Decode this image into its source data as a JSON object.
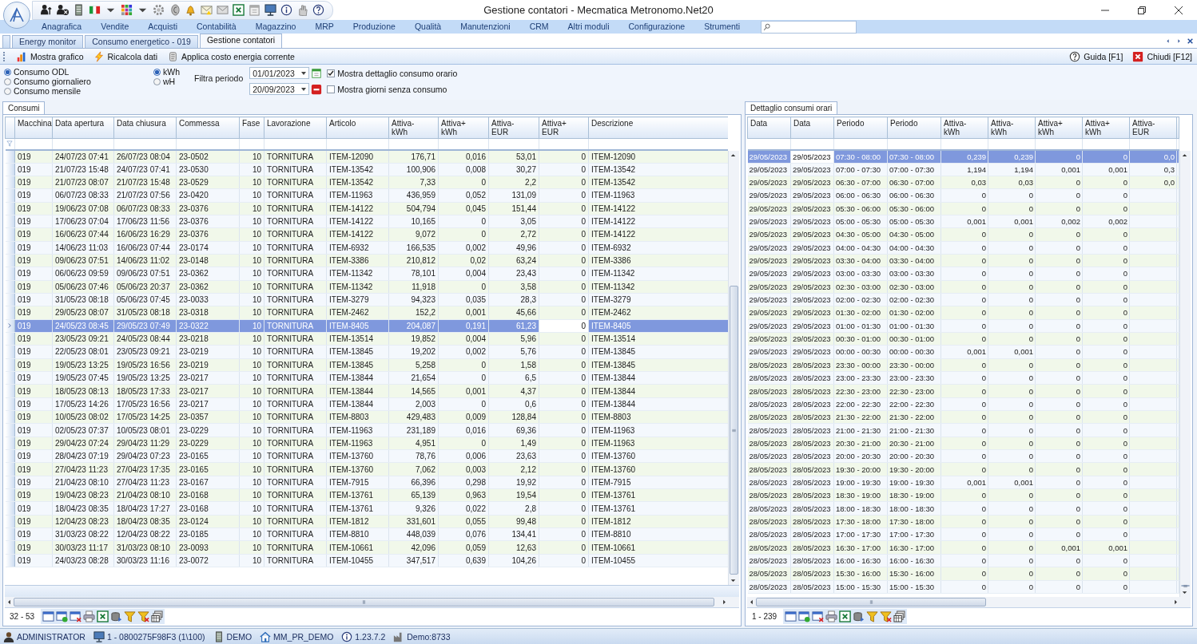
{
  "window": {
    "title": "Gestione contatori - Mecmatica Metronomo.Net20"
  },
  "menu": [
    "Anagrafica",
    "Vendite",
    "Acquisti",
    "Contabilità",
    "Magazzino",
    "MRP",
    "Produzione",
    "Qualità",
    "Manutenzioni",
    "CRM",
    "Altri moduli",
    "Configurazione",
    "Strumenti"
  ],
  "doc_tabs": [
    {
      "label": "Energy monitor",
      "selected": false
    },
    {
      "label": "Consumo energetico - 019",
      "selected": false
    },
    {
      "label": "Gestione contatori",
      "selected": true
    }
  ],
  "toolbar": {
    "left": [
      {
        "kind": "chart",
        "label": "Mostra grafico"
      },
      {
        "kind": "lightning",
        "label": "Ricalcola dati"
      },
      {
        "kind": "scroll",
        "label": "Applica costo energia corrente"
      }
    ],
    "right": [
      {
        "kind": "help",
        "label": "Guida [F1]"
      },
      {
        "kind": "close",
        "label": "Chiudi [F12]"
      }
    ]
  },
  "mode": [
    {
      "label": "Consumo ODL",
      "selected": true
    },
    {
      "label": "Consumo giornaliero",
      "selected": false
    },
    {
      "label": "Consumo mensile",
      "selected": false
    }
  ],
  "unit": [
    {
      "label": "kWh",
      "selected": true
    },
    {
      "label": "wH",
      "selected": false
    }
  ],
  "filter": {
    "label": "Filtra periodo",
    "from": "01/01/2023",
    "to": "20/09/2023"
  },
  "options": [
    {
      "label": "Mostra dettaglio consumo orario",
      "checked": true
    },
    {
      "label": "Mostra giorni senza consumo",
      "checked": false
    }
  ],
  "consumi": {
    "tab": "Consumi",
    "pager": "32 - 53",
    "columns": [
      {
        "label": "Macchina",
        "numeric": false
      },
      {
        "label": "Data apertura",
        "numeric": false
      },
      {
        "label": "Data chiusura",
        "numeric": false
      },
      {
        "label": "Commessa",
        "numeric": false
      },
      {
        "label": "Fase",
        "numeric": true
      },
      {
        "label": "Lavorazione",
        "numeric": false
      },
      {
        "label": "Articolo",
        "numeric": false
      },
      {
        "label": "Attiva-\nkWh",
        "numeric": true
      },
      {
        "label": "Attiva+\nkWh",
        "numeric": true
      },
      {
        "label": "Attiva-\nEUR",
        "numeric": true
      },
      {
        "label": "Attiva+\nEUR",
        "numeric": true
      },
      {
        "label": "Descrizione",
        "numeric": false
      }
    ],
    "rows": [
      {
        "selected": false,
        "cells": [
          "019",
          "24/07/23 07:41",
          "26/07/23 08:04",
          "23-0502",
          "10",
          "TORNITURA",
          "ITEM-12090",
          "176,71",
          "0,016",
          "53,01",
          "0",
          "ITEM-12090"
        ]
      },
      {
        "selected": false,
        "cells": [
          "019",
          "21/07/23 15:48",
          "24/07/23 07:41",
          "23-0530",
          "10",
          "TORNITURA",
          "ITEM-13542",
          "100,906",
          "0,008",
          "30,27",
          "0",
          "ITEM-13542"
        ]
      },
      {
        "selected": false,
        "cells": [
          "019",
          "21/07/23 08:07",
          "21/07/23 15:48",
          "23-0529",
          "10",
          "TORNITURA",
          "ITEM-13542",
          "7,33",
          "0",
          "2,2",
          "0",
          "ITEM-13542"
        ]
      },
      {
        "selected": false,
        "cells": [
          "019",
          "06/07/23 08:33",
          "21/07/23 07:56",
          "23-0420",
          "10",
          "TORNITURA",
          "ITEM-11963",
          "436,959",
          "0,052",
          "131,09",
          "0",
          "ITEM-11963"
        ]
      },
      {
        "selected": false,
        "cells": [
          "019",
          "19/06/23 07:08",
          "06/07/23 08:33",
          "23-0376",
          "10",
          "TORNITURA",
          "ITEM-14122",
          "504,794",
          "0,045",
          "151,44",
          "0",
          "ITEM-14122"
        ]
      },
      {
        "selected": false,
        "cells": [
          "019",
          "17/06/23 07:04",
          "17/06/23 11:56",
          "23-0376",
          "10",
          "TORNITURA",
          "ITEM-14122",
          "10,165",
          "0",
          "3,05",
          "0",
          "ITEM-14122"
        ]
      },
      {
        "selected": false,
        "cells": [
          "019",
          "16/06/23 07:44",
          "16/06/23 16:29",
          "23-0376",
          "10",
          "TORNITURA",
          "ITEM-14122",
          "9,072",
          "0",
          "2,72",
          "0",
          "ITEM-14122"
        ]
      },
      {
        "selected": false,
        "cells": [
          "019",
          "14/06/23 11:03",
          "16/06/23 07:44",
          "23-0174",
          "10",
          "TORNITURA",
          "ITEM-6932",
          "166,535",
          "0,002",
          "49,96",
          "0",
          "ITEM-6932"
        ]
      },
      {
        "selected": false,
        "cells": [
          "019",
          "09/06/23 07:51",
          "14/06/23 11:02",
          "23-0148",
          "10",
          "TORNITURA",
          "ITEM-3386",
          "210,812",
          "0,02",
          "63,24",
          "0",
          "ITEM-3386"
        ]
      },
      {
        "selected": false,
        "cells": [
          "019",
          "06/06/23 09:59",
          "09/06/23 07:51",
          "23-0362",
          "10",
          "TORNITURA",
          "ITEM-11342",
          "78,101",
          "0,004",
          "23,43",
          "0",
          "ITEM-11342"
        ]
      },
      {
        "selected": false,
        "cells": [
          "019",
          "05/06/23 07:46",
          "05/06/23 20:37",
          "23-0362",
          "10",
          "TORNITURA",
          "ITEM-11342",
          "11,918",
          "0",
          "3,58",
          "0",
          "ITEM-11342"
        ]
      },
      {
        "selected": false,
        "cells": [
          "019",
          "31/05/23 08:18",
          "05/06/23 07:45",
          "23-0033",
          "10",
          "TORNITURA",
          "ITEM-3279",
          "94,323",
          "0,035",
          "28,3",
          "0",
          "ITEM-3279"
        ]
      },
      {
        "selected": false,
        "cells": [
          "019",
          "29/05/23 08:07",
          "31/05/23 08:18",
          "23-0318",
          "10",
          "TORNITURA",
          "ITEM-2462",
          "152,2",
          "0,001",
          "45,66",
          "0",
          "ITEM-2462"
        ]
      },
      {
        "selected": true,
        "cells": [
          "019",
          "24/05/23 08:45",
          "29/05/23 07:49",
          "23-0322",
          "10",
          "TORNITURA",
          "ITEM-8405",
          "204,087",
          "0,191",
          "61,23",
          {
            "text": "0",
            "focused": true
          },
          "ITEM-8405"
        ]
      },
      {
        "selected": false,
        "cells": [
          "019",
          "23/05/23 09:21",
          "24/05/23 08:44",
          "23-0218",
          "10",
          "TORNITURA",
          "ITEM-13514",
          "19,852",
          "0,004",
          "5,96",
          "0",
          "ITEM-13514"
        ]
      },
      {
        "selected": false,
        "cells": [
          "019",
          "22/05/23 08:01",
          "23/05/23 09:21",
          "23-0219",
          "10",
          "TORNITURA",
          "ITEM-13845",
          "19,202",
          "0,002",
          "5,76",
          "0",
          "ITEM-13845"
        ]
      },
      {
        "selected": false,
        "cells": [
          "019",
          "19/05/23 13:25",
          "19/05/23 16:56",
          "23-0219",
          "10",
          "TORNITURA",
          "ITEM-13845",
          "5,258",
          "0",
          "1,58",
          "0",
          "ITEM-13845"
        ]
      },
      {
        "selected": false,
        "cells": [
          "019",
          "19/05/23 07:45",
          "19/05/23 13:25",
          "23-0217",
          "10",
          "TORNITURA",
          "ITEM-13844",
          "21,654",
          "0",
          "6,5",
          "0",
          "ITEM-13844"
        ]
      },
      {
        "selected": false,
        "cells": [
          "019",
          "18/05/23 08:13",
          "18/05/23 17:33",
          "23-0217",
          "10",
          "TORNITURA",
          "ITEM-13844",
          "14,565",
          "0,001",
          "4,37",
          "0",
          "ITEM-13844"
        ]
      },
      {
        "selected": false,
        "cells": [
          "019",
          "17/05/23 14:26",
          "17/05/23 16:56",
          "23-0217",
          "10",
          "TORNITURA",
          "ITEM-13844",
          "2,003",
          "0",
          "0,6",
          "0",
          "ITEM-13844"
        ]
      },
      {
        "selected": false,
        "cells": [
          "019",
          "10/05/23 08:02",
          "17/05/23 14:25",
          "23-0357",
          "10",
          "TORNITURA",
          "ITEM-8803",
          "429,483",
          "0,009",
          "128,84",
          "0",
          "ITEM-8803"
        ]
      },
      {
        "selected": false,
        "cells": [
          "019",
          "02/05/23 07:37",
          "10/05/23 08:01",
          "23-0229",
          "10",
          "TORNITURA",
          "ITEM-11963",
          "231,189",
          "0,016",
          "69,36",
          "0",
          "ITEM-11963"
        ]
      },
      {
        "selected": false,
        "cells": [
          "019",
          "29/04/23 07:24",
          "29/04/23 11:29",
          "23-0229",
          "10",
          "TORNITURA",
          "ITEM-11963",
          "4,951",
          "0",
          "1,49",
          "0",
          "ITEM-11963"
        ]
      },
      {
        "selected": false,
        "cells": [
          "019",
          "28/04/23 07:19",
          "29/04/23 07:23",
          "23-0165",
          "10",
          "TORNITURA",
          "ITEM-13760",
          "78,76",
          "0,006",
          "23,63",
          "0",
          "ITEM-13760"
        ]
      },
      {
        "selected": false,
        "cells": [
          "019",
          "27/04/23 11:23",
          "27/04/23 17:35",
          "23-0165",
          "10",
          "TORNITURA",
          "ITEM-13760",
          "7,062",
          "0,003",
          "2,12",
          "0",
          "ITEM-13760"
        ]
      },
      {
        "selected": false,
        "cells": [
          "019",
          "21/04/23 08:10",
          "27/04/23 11:23",
          "23-0167",
          "10",
          "TORNITURA",
          "ITEM-7915",
          "66,396",
          "0,298",
          "19,92",
          "0",
          "ITEM-7915"
        ]
      },
      {
        "selected": false,
        "cells": [
          "019",
          "19/04/23 08:23",
          "21/04/23 08:10",
          "23-0168",
          "10",
          "TORNITURA",
          "ITEM-13761",
          "65,139",
          "0,963",
          "19,54",
          "0",
          "ITEM-13761"
        ]
      },
      {
        "selected": false,
        "cells": [
          "019",
          "18/04/23 08:35",
          "18/04/23 17:27",
          "23-0168",
          "10",
          "TORNITURA",
          "ITEM-13761",
          "9,326",
          "0,022",
          "2,8",
          "0",
          "ITEM-13761"
        ]
      },
      {
        "selected": false,
        "cells": [
          "019",
          "12/04/23 08:23",
          "18/04/23 08:35",
          "23-0124",
          "10",
          "TORNITURA",
          "ITEM-1812",
          "331,601",
          "0,055",
          "99,48",
          "0",
          "ITEM-1812"
        ]
      },
      {
        "selected": false,
        "cells": [
          "019",
          "31/03/23 08:22",
          "12/04/23 08:22",
          "23-0185",
          "10",
          "TORNITURA",
          "ITEM-8810",
          "448,039",
          "0,076",
          "134,41",
          "0",
          "ITEM-8810"
        ]
      },
      {
        "selected": false,
        "cells": [
          "019",
          "30/03/23 11:17",
          "31/03/23 08:10",
          "23-0093",
          "10",
          "TORNITURA",
          "ITEM-10661",
          "42,096",
          "0,059",
          "12,63",
          "0",
          "ITEM-10661"
        ]
      },
      {
        "selected": false,
        "cells": [
          "019",
          "24/03/23 08:28",
          "30/03/23 11:16",
          "23-0072",
          "10",
          "TORNITURA",
          "ITEM-10455",
          "347,517",
          "0,639",
          "104,26",
          "0",
          "ITEM-10455"
        ]
      }
    ]
  },
  "dettaglio": {
    "tab": "Dettaglio consumi orari",
    "pager": "1 - 239",
    "columns": [
      {
        "label": "Data",
        "numeric": false
      },
      {
        "label": "Data",
        "numeric": false
      },
      {
        "label": "Periodo",
        "numeric": false
      },
      {
        "label": "Periodo",
        "numeric": false
      },
      {
        "label": "Attiva-\nkWh",
        "numeric": true
      },
      {
        "label": "Attiva-\nkWh",
        "numeric": true
      },
      {
        "label": "Attiva+\nkWh",
        "numeric": true
      },
      {
        "label": "Attiva+\nkWh",
        "numeric": true
      },
      {
        "label": "Attiva-\nEUR",
        "numeric": true
      }
    ],
    "rows": [
      {
        "selected": true,
        "cells": [
          "29/05/2023",
          {
            "text": "29/05/2023",
            "focused": true
          },
          "07:30 - 08:00",
          "07:30 - 08:00",
          "0,239",
          "0,239",
          "0",
          "0",
          "0,0"
        ]
      },
      {
        "selected": false,
        "cells": [
          "29/05/2023",
          "29/05/2023",
          "07:00 - 07:30",
          "07:00 - 07:30",
          "1,194",
          "1,194",
          "0,001",
          "0,001",
          "0,3"
        ]
      },
      {
        "selected": false,
        "cells": [
          "29/05/2023",
          "29/05/2023",
          "06:30 - 07:00",
          "06:30 - 07:00",
          "0,03",
          "0,03",
          "0",
          "0",
          "0,0"
        ]
      },
      {
        "selected": false,
        "cells": [
          "29/05/2023",
          "29/05/2023",
          "06:00 - 06:30",
          "06:00 - 06:30",
          "0",
          "0",
          "0",
          "0"
        ]
      },
      {
        "selected": false,
        "cells": [
          "29/05/2023",
          "29/05/2023",
          "05:30 - 06:00",
          "05:30 - 06:00",
          "0",
          "0",
          "0",
          "0"
        ]
      },
      {
        "selected": false,
        "cells": [
          "29/05/2023",
          "29/05/2023",
          "05:00 - 05:30",
          "05:00 - 05:30",
          "0,001",
          "0,001",
          "0,002",
          "0,002"
        ]
      },
      {
        "selected": false,
        "cells": [
          "29/05/2023",
          "29/05/2023",
          "04:30 - 05:00",
          "04:30 - 05:00",
          "0",
          "0",
          "0",
          "0"
        ]
      },
      {
        "selected": false,
        "cells": [
          "29/05/2023",
          "29/05/2023",
          "04:00 - 04:30",
          "04:00 - 04:30",
          "0",
          "0",
          "0",
          "0"
        ]
      },
      {
        "selected": false,
        "cells": [
          "29/05/2023",
          "29/05/2023",
          "03:30 - 04:00",
          "03:30 - 04:00",
          "0",
          "0",
          "0",
          "0"
        ]
      },
      {
        "selected": false,
        "cells": [
          "29/05/2023",
          "29/05/2023",
          "03:00 - 03:30",
          "03:00 - 03:30",
          "0",
          "0",
          "0",
          "0"
        ]
      },
      {
        "selected": false,
        "cells": [
          "29/05/2023",
          "29/05/2023",
          "02:30 - 03:00",
          "02:30 - 03:00",
          "0",
          "0",
          "0",
          "0"
        ]
      },
      {
        "selected": false,
        "cells": [
          "29/05/2023",
          "29/05/2023",
          "02:00 - 02:30",
          "02:00 - 02:30",
          "0",
          "0",
          "0",
          "0"
        ]
      },
      {
        "selected": false,
        "cells": [
          "29/05/2023",
          "29/05/2023",
          "01:30 - 02:00",
          "01:30 - 02:00",
          "0",
          "0",
          "0",
          "0"
        ]
      },
      {
        "selected": false,
        "cells": [
          "29/05/2023",
          "29/05/2023",
          "01:00 - 01:30",
          "01:00 - 01:30",
          "0",
          "0",
          "0",
          "0"
        ]
      },
      {
        "selected": false,
        "cells": [
          "29/05/2023",
          "29/05/2023",
          "00:30 - 01:00",
          "00:30 - 01:00",
          "0",
          "0",
          "0",
          "0"
        ]
      },
      {
        "selected": false,
        "cells": [
          "29/05/2023",
          "29/05/2023",
          "00:00 - 00:30",
          "00:00 - 00:30",
          "0,001",
          "0,001",
          "0",
          "0"
        ]
      },
      {
        "selected": false,
        "cells": [
          "28/05/2023",
          "28/05/2023",
          "23:30 - 00:00",
          "23:30 - 00:00",
          "0",
          "0",
          "0",
          "0"
        ]
      },
      {
        "selected": false,
        "cells": [
          "28/05/2023",
          "28/05/2023",
          "23:00 - 23:30",
          "23:00 - 23:30",
          "0",
          "0",
          "0",
          "0"
        ]
      },
      {
        "selected": false,
        "cells": [
          "28/05/2023",
          "28/05/2023",
          "22:30 - 23:00",
          "22:30 - 23:00",
          "0",
          "0",
          "0",
          "0"
        ]
      },
      {
        "selected": false,
        "cells": [
          "28/05/2023",
          "28/05/2023",
          "22:00 - 22:30",
          "22:00 - 22:30",
          "0",
          "0",
          "0",
          "0"
        ]
      },
      {
        "selected": false,
        "cells": [
          "28/05/2023",
          "28/05/2023",
          "21:30 - 22:00",
          "21:30 - 22:00",
          "0",
          "0",
          "0",
          "0"
        ]
      },
      {
        "selected": false,
        "cells": [
          "28/05/2023",
          "28/05/2023",
          "21:00 - 21:30",
          "21:00 - 21:30",
          "0",
          "0",
          "0",
          "0"
        ]
      },
      {
        "selected": false,
        "cells": [
          "28/05/2023",
          "28/05/2023",
          "20:30 - 21:00",
          "20:30 - 21:00",
          "0",
          "0",
          "0",
          "0"
        ]
      },
      {
        "selected": false,
        "cells": [
          "28/05/2023",
          "28/05/2023",
          "20:00 - 20:30",
          "20:00 - 20:30",
          "0",
          "0",
          "0",
          "0"
        ]
      },
      {
        "selected": false,
        "cells": [
          "28/05/2023",
          "28/05/2023",
          "19:30 - 20:00",
          "19:30 - 20:00",
          "0",
          "0",
          "0",
          "0"
        ]
      },
      {
        "selected": false,
        "cells": [
          "28/05/2023",
          "28/05/2023",
          "19:00 - 19:30",
          "19:00 - 19:30",
          "0,001",
          "0,001",
          "0",
          "0"
        ]
      },
      {
        "selected": false,
        "cells": [
          "28/05/2023",
          "28/05/2023",
          "18:30 - 19:00",
          "18:30 - 19:00",
          "0",
          "0",
          "0",
          "0"
        ]
      },
      {
        "selected": false,
        "cells": [
          "28/05/2023",
          "28/05/2023",
          "18:00 - 18:30",
          "18:00 - 18:30",
          "0",
          "0",
          "0",
          "0"
        ]
      },
      {
        "selected": false,
        "cells": [
          "28/05/2023",
          "28/05/2023",
          "17:30 - 18:00",
          "17:30 - 18:00",
          "0",
          "0",
          "0",
          "0"
        ]
      },
      {
        "selected": false,
        "cells": [
          "28/05/2023",
          "28/05/2023",
          "17:00 - 17:30",
          "17:00 - 17:30",
          "0",
          "0",
          "0",
          "0"
        ]
      },
      {
        "selected": false,
        "cells": [
          "28/05/2023",
          "28/05/2023",
          "16:30 - 17:00",
          "16:30 - 17:00",
          "0",
          "0",
          "0,001",
          "0,001"
        ]
      },
      {
        "selected": false,
        "cells": [
          "28/05/2023",
          "28/05/2023",
          "16:00 - 16:30",
          "16:00 - 16:30",
          "0",
          "0",
          "0",
          "0"
        ]
      },
      {
        "selected": false,
        "cells": [
          "28/05/2023",
          "28/05/2023",
          "15:30 - 16:00",
          "15:30 - 16:00",
          "0",
          "0",
          "0",
          "0"
        ]
      },
      {
        "selected": false,
        "cells": [
          "28/05/2023",
          "28/05/2023",
          "15:00 - 15:30",
          "15:00 - 15:30",
          "0",
          "0",
          "0",
          "0"
        ]
      }
    ]
  },
  "status_bar": [
    {
      "kind": "user",
      "text": "ADMINISTRATOR"
    },
    {
      "kind": "computer",
      "text": "1 - 0800275F98F3 (1\\100)"
    },
    {
      "kind": "database",
      "text": "DEMO"
    },
    {
      "kind": "home",
      "text": "MM_PR_DEMO"
    },
    {
      "kind": "info",
      "text": "1.23.7.2"
    },
    {
      "kind": "factory",
      "text": "Demo:8733"
    }
  ]
}
